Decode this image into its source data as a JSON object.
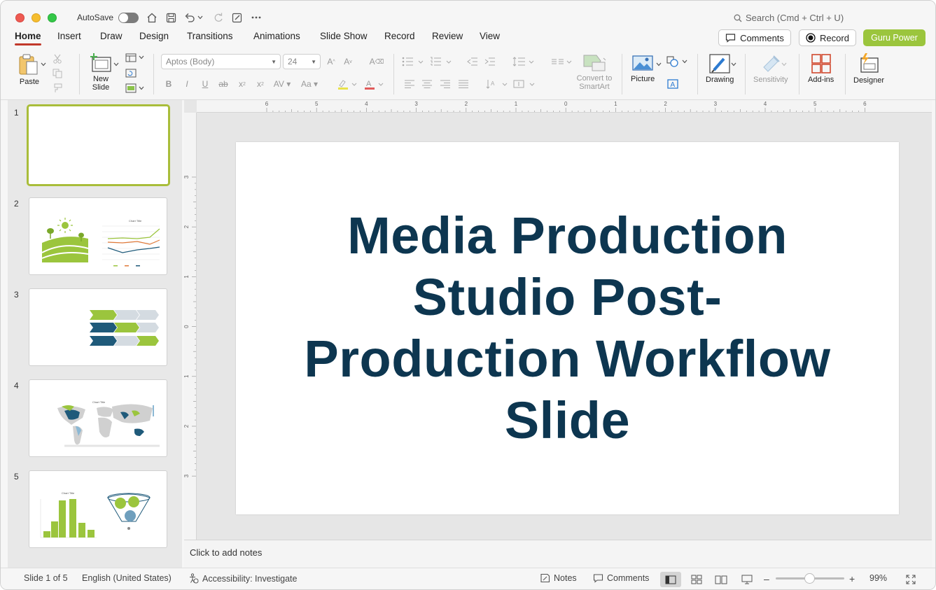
{
  "titlebar": {
    "autosave_label": "AutoSave",
    "search_placeholder": "Search (Cmd + Ctrl + U)"
  },
  "tabs": [
    "Home",
    "Insert",
    "Draw",
    "Design",
    "Transitions",
    "Animations",
    "Slide Show",
    "Record",
    "Review",
    "View"
  ],
  "active_tab": "Home",
  "actions": {
    "comments": "Comments",
    "record": "Record",
    "guru": "Guru Power"
  },
  "ribbon": {
    "paste": "Paste",
    "new_slide": "New Slide",
    "font_name": "Aptos (Body)",
    "font_size": "24",
    "convert_smartart": "Convert to SmartArt",
    "picture": "Picture",
    "drawing": "Drawing",
    "sensitivity": "Sensitivity",
    "addins": "Add-ins",
    "designer": "Designer"
  },
  "slides": [
    {
      "number": "1"
    },
    {
      "number": "2"
    },
    {
      "number": "3"
    },
    {
      "number": "4"
    },
    {
      "number": "5"
    }
  ],
  "thumb_texts": {
    "chart_title": "Chart Title"
  },
  "ruler": {
    "h_labels": [
      "6",
      "5",
      "4",
      "3",
      "2",
      "1",
      "0",
      "1",
      "2",
      "3",
      "4",
      "5",
      "6"
    ],
    "v_labels": [
      "3",
      "2",
      "1",
      "0",
      "1",
      "2",
      "3"
    ]
  },
  "slide": {
    "title": "Media Production Studio Post-Production Workflow Slide"
  },
  "notes_placeholder": "Click to add notes",
  "status": {
    "slide_count": "Slide 1 of 5",
    "language": "English (United States)",
    "accessibility": "Accessibility: Investigate",
    "notes": "Notes",
    "comments": "Comments",
    "zoom": "99%"
  },
  "colors": {
    "accent_green": "#9bc53d",
    "slide_title": "#0d3650",
    "tab_underline": "#c1392b"
  }
}
